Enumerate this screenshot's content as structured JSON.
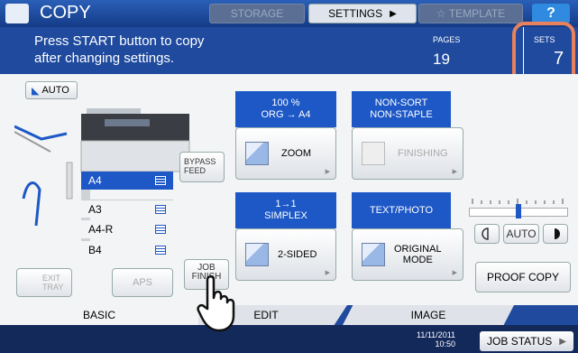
{
  "titlebar": {
    "title": "COPY",
    "storage": "STORAGE",
    "settings": "SETTINGS",
    "template": "TEMPLATE",
    "help": "?"
  },
  "message": {
    "line1": "Press START button to copy",
    "line2": "after changing settings."
  },
  "counters": {
    "pages_label": "PAGES",
    "pages": "19",
    "sets_label": "SETS",
    "sets": "7"
  },
  "left": {
    "auto": "AUTO",
    "bypass": [
      "BYPASS",
      "FEED"
    ],
    "trays": [
      "A4",
      "A3",
      "A4-R",
      "B4"
    ],
    "exit": [
      "EXIT",
      "TRAY"
    ],
    "aps": "APS",
    "job_finish": [
      "JOB",
      "FINISH"
    ]
  },
  "functions": {
    "zoom_head": [
      "100 %",
      "ORG  →   A4"
    ],
    "zoom": "ZOOM",
    "finishing_head": [
      "NON-SORT",
      "NON-STAPLE"
    ],
    "finishing": "FINISHING",
    "duplex_head": [
      "1→1",
      "SIMPLEX"
    ],
    "duplex": "2-SIDED",
    "mode_head": "TEXT/PHOTO",
    "mode": [
      "ORIGINAL",
      "MODE"
    ]
  },
  "density": {
    "auto": "AUTO",
    "level": 0.5
  },
  "proof_copy": "PROOF COPY",
  "tabs": {
    "basic": "BASIC",
    "edit": "EDIT",
    "image": "IMAGE"
  },
  "status": {
    "date": "11/11/2011",
    "time": "10:50",
    "job_status": "JOB STATUS"
  },
  "colors": {
    "accent": "#1d58c6",
    "highlight": "#e8815c"
  }
}
